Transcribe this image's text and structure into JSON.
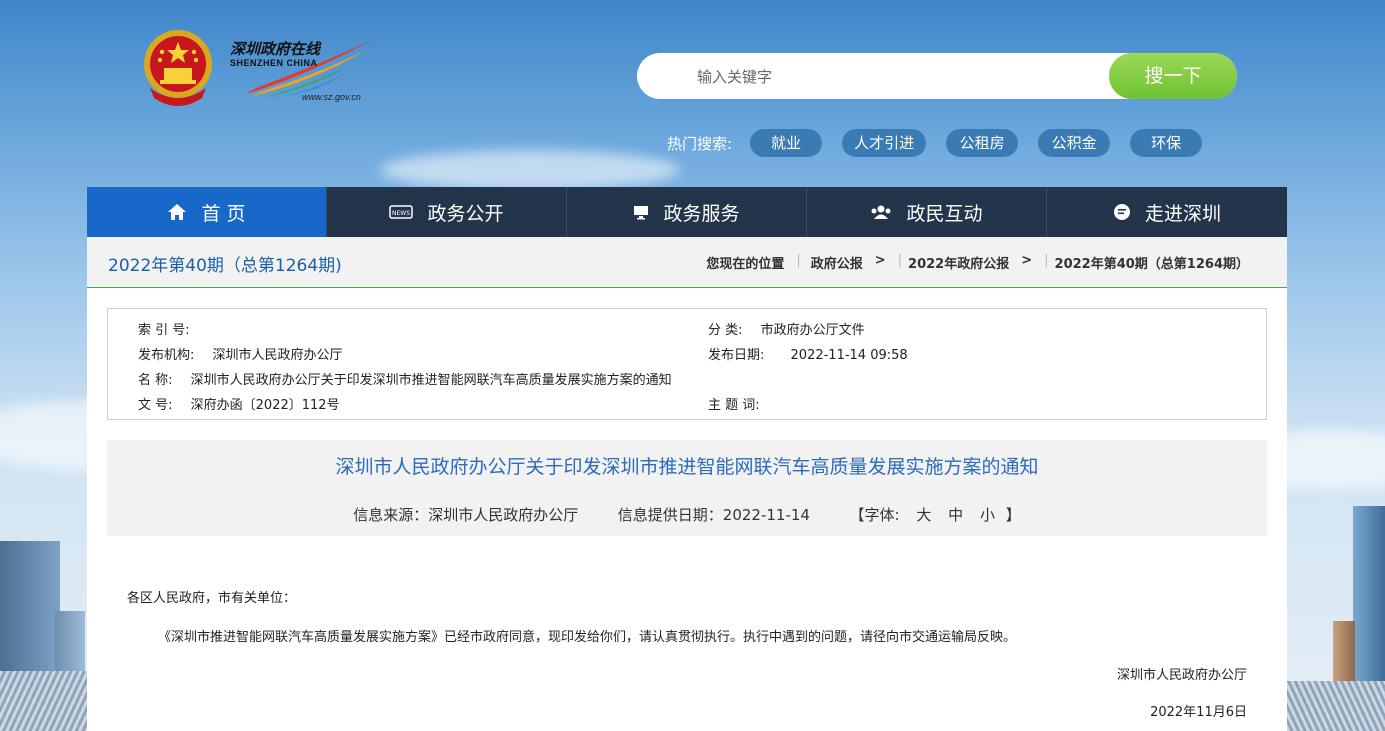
{
  "header": {
    "logo_cn": "深圳政府在线",
    "logo_en": "SHENZHEN CHINA",
    "logo_url": "www.sz.gov.cn",
    "search_placeholder": "输入关键字",
    "search_button": "搜一下",
    "hot_label": "热门搜索:",
    "hot_tags": [
      "就业",
      "人才引进",
      "公租房",
      "公积金",
      "环保"
    ]
  },
  "nav": {
    "items": [
      {
        "label": "首 页",
        "icon": "home-icon"
      },
      {
        "label": "政务公开",
        "icon": "news-icon"
      },
      {
        "label": "政务服务",
        "icon": "monitor-icon"
      },
      {
        "label": "政民互动",
        "icon": "people-icon"
      },
      {
        "label": "走进深圳",
        "icon": "chat-icon"
      }
    ]
  },
  "crumbbar": {
    "issue": "2022年第40期（总第1264期)",
    "location_label": "您现在的位置",
    "crumbs": [
      "政府公报",
      "2022年政府公报",
      "2022年第40期（总第1264期）"
    ]
  },
  "meta": {
    "index_label": "索 引 号:",
    "index_value": "",
    "category_label": "分 类:",
    "category_value": "市政府办公厅文件",
    "publisher_label": "发布机构:",
    "publisher_value": "深圳市人民政府办公厅",
    "date_label": "发布日期:",
    "date_value": "2022-11-14 09:58",
    "name_label": "名 称:",
    "name_value": "深圳市人民政府办公厅关于印发深圳市推进智能网联汽车高质量发展实施方案的通知",
    "docno_label": "文 号:",
    "docno_value": "深府办函〔2022〕112号",
    "subject_label": "主 题 词:",
    "subject_value": ""
  },
  "article": {
    "title": "深圳市人民政府办公厅关于印发深圳市推进智能网联汽车高质量发展实施方案的通知",
    "source": "信息来源：深圳市人民政府办公厅",
    "provided_date": "信息提供日期：2022-11-14",
    "font_label": "【字体:",
    "font_large": "大",
    "font_medium": "中",
    "font_small": "小",
    "font_close": "】",
    "salutation": "各区人民政府，市有关单位：",
    "paragraph": "《深圳市推进智能网联汽车高质量发展实施方案》已经市政府同意，现印发给你们，请认真贯彻执行。执行中遇到的问题，请径向市交通运输局反映。",
    "signature": "深圳市人民政府办公厅",
    "sign_date": "2022年11月6日"
  },
  "colors": {
    "nav_bg": "#24344a",
    "nav_active": "#1768c9",
    "search_button": "#7cc93f",
    "title": "#2d6bbd",
    "divider": "#3cae4f"
  }
}
